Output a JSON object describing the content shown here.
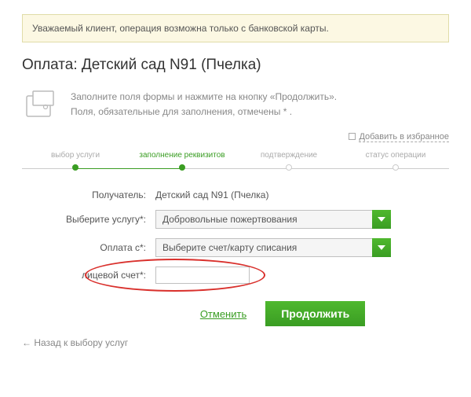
{
  "alert": {
    "text": "Уважаемый клиент, операция возможна только с банковской карты."
  },
  "title": "Оплата: Детский сад N91 (Пчелка)",
  "info": {
    "line1": "Заполните поля формы и нажмите на кнопку «Продолжить».",
    "line2": "Поля, обязательные для заполнения, отмечены * ."
  },
  "favorites": {
    "label": "Добавить в избранное"
  },
  "steps": {
    "s1": "выбор услуги",
    "s2": "заполнение реквизитов",
    "s3": "подтверждение",
    "s4": "статус операции"
  },
  "form": {
    "recipient_label": "Получатель:",
    "recipient_value": "Детский сад N91 (Пчелка)",
    "service_label": "Выберите услугу*:",
    "service_value": "Добровольные пожертвования",
    "payfrom_label": "Оплата с*:",
    "payfrom_value": "Выберите счет/карту списания",
    "account_label": "лицевой счет*:",
    "account_value": ""
  },
  "actions": {
    "cancel": "Отменить",
    "continue": "Продолжить"
  },
  "back": "Назад к выбору услуг"
}
